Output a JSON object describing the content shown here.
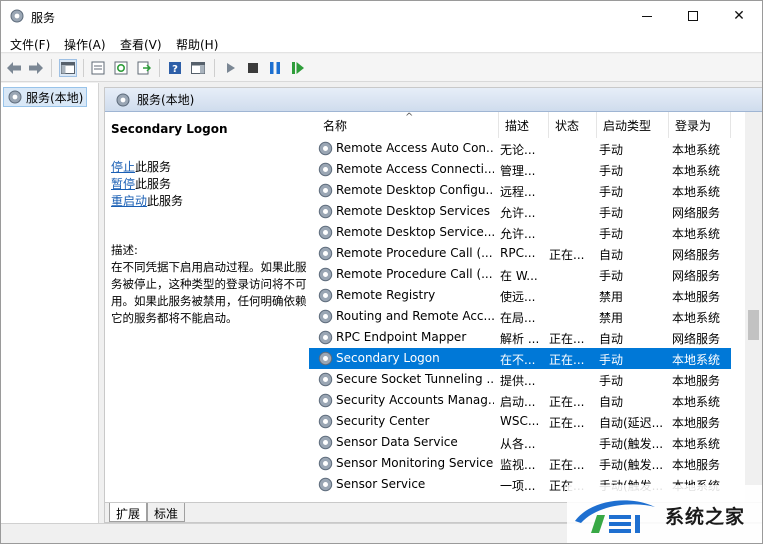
{
  "window": {
    "title": "服务",
    "minimize_glyph": "—",
    "maximize_glyph": "□",
    "close_glyph": "✕"
  },
  "menu": {
    "items": [
      "文件(F)",
      "操作(A)",
      "查看(V)",
      "帮助(H)"
    ]
  },
  "toolbar": {
    "icons": [
      "back-arrow-icon",
      "forward-arrow-icon",
      "show-console-tree-icon",
      "properties-icon",
      "refresh-icon",
      "export-list-icon",
      "help-icon",
      "show-action-pane-icon",
      "start-service-icon",
      "stop-service-icon",
      "pause-service-icon",
      "restart-service-icon"
    ]
  },
  "tree": {
    "selected": "服务(本地)"
  },
  "panel": {
    "header": "服务(本地)",
    "service_title": "Secondary Logon",
    "actions": [
      {
        "link": "停止",
        "suffix": "此服务"
      },
      {
        "link": "暂停",
        "suffix": "此服务"
      },
      {
        "link": "重启动",
        "suffix": "此服务"
      }
    ],
    "description_label": "描述:",
    "description": "在不同凭据下启用启动过程。如果此服务被停止，这种类型的登录访问将不可用。如果此服务被禁用，任何明确依赖它的服务都将不能启动。"
  },
  "columns": {
    "name": "名称",
    "description": "描述",
    "status": "状态",
    "startup": "启动类型",
    "logon": "登录为"
  },
  "services": [
    {
      "name": "Remote Access Auto Con...",
      "desc": "无论...",
      "status": "",
      "startup": "手动",
      "logon": "本地系统"
    },
    {
      "name": "Remote Access Connecti...",
      "desc": "管理...",
      "status": "",
      "startup": "手动",
      "logon": "本地系统"
    },
    {
      "name": "Remote Desktop Configu...",
      "desc": "远程...",
      "status": "",
      "startup": "手动",
      "logon": "本地系统"
    },
    {
      "name": "Remote Desktop Services",
      "desc": "允许...",
      "status": "",
      "startup": "手动",
      "logon": "网络服务"
    },
    {
      "name": "Remote Desktop Service...",
      "desc": "允许...",
      "status": "",
      "startup": "手动",
      "logon": "本地系统"
    },
    {
      "name": "Remote Procedure Call (...",
      "desc": "RPC...",
      "status": "正在...",
      "startup": "自动",
      "logon": "网络服务"
    },
    {
      "name": "Remote Procedure Call (...",
      "desc": "在 W...",
      "status": "",
      "startup": "手动",
      "logon": "网络服务"
    },
    {
      "name": "Remote Registry",
      "desc": "使远...",
      "status": "",
      "startup": "禁用",
      "logon": "本地服务"
    },
    {
      "name": "Routing and Remote Acc...",
      "desc": "在局...",
      "status": "",
      "startup": "禁用",
      "logon": "本地系统"
    },
    {
      "name": "RPC Endpoint Mapper",
      "desc": "解析 ...",
      "status": "正在...",
      "startup": "自动",
      "logon": "网络服务"
    },
    {
      "name": "Secondary Logon",
      "desc": "在不...",
      "status": "正在...",
      "startup": "手动",
      "logon": "本地系统",
      "selected": true
    },
    {
      "name": "Secure Socket Tunneling ...",
      "desc": "提供...",
      "status": "",
      "startup": "手动",
      "logon": "本地服务"
    },
    {
      "name": "Security Accounts Manag...",
      "desc": "启动...",
      "status": "正在...",
      "startup": "自动",
      "logon": "本地系统"
    },
    {
      "name": "Security Center",
      "desc": "WSC...",
      "status": "正在...",
      "startup": "自动(延迟...",
      "logon": "本地服务"
    },
    {
      "name": "Sensor Data Service",
      "desc": "从各...",
      "status": "",
      "startup": "手动(触发...",
      "logon": "本地系统"
    },
    {
      "name": "Sensor Monitoring Service",
      "desc": "监视...",
      "status": "正在...",
      "startup": "手动(触发...",
      "logon": "本地服务"
    },
    {
      "name": "Sensor Service",
      "desc": "一项...",
      "status": "正在...",
      "startup": "手动(触发...",
      "logon": "本地系统"
    }
  ],
  "tabs": [
    "扩展",
    "标准"
  ],
  "watermark": {
    "text": "系统之家",
    "colors": {
      "blue": "#1e6fd0",
      "green": "#38a845"
    }
  },
  "colors": {
    "selection": "#0078d7",
    "link": "#1a5fb4"
  }
}
